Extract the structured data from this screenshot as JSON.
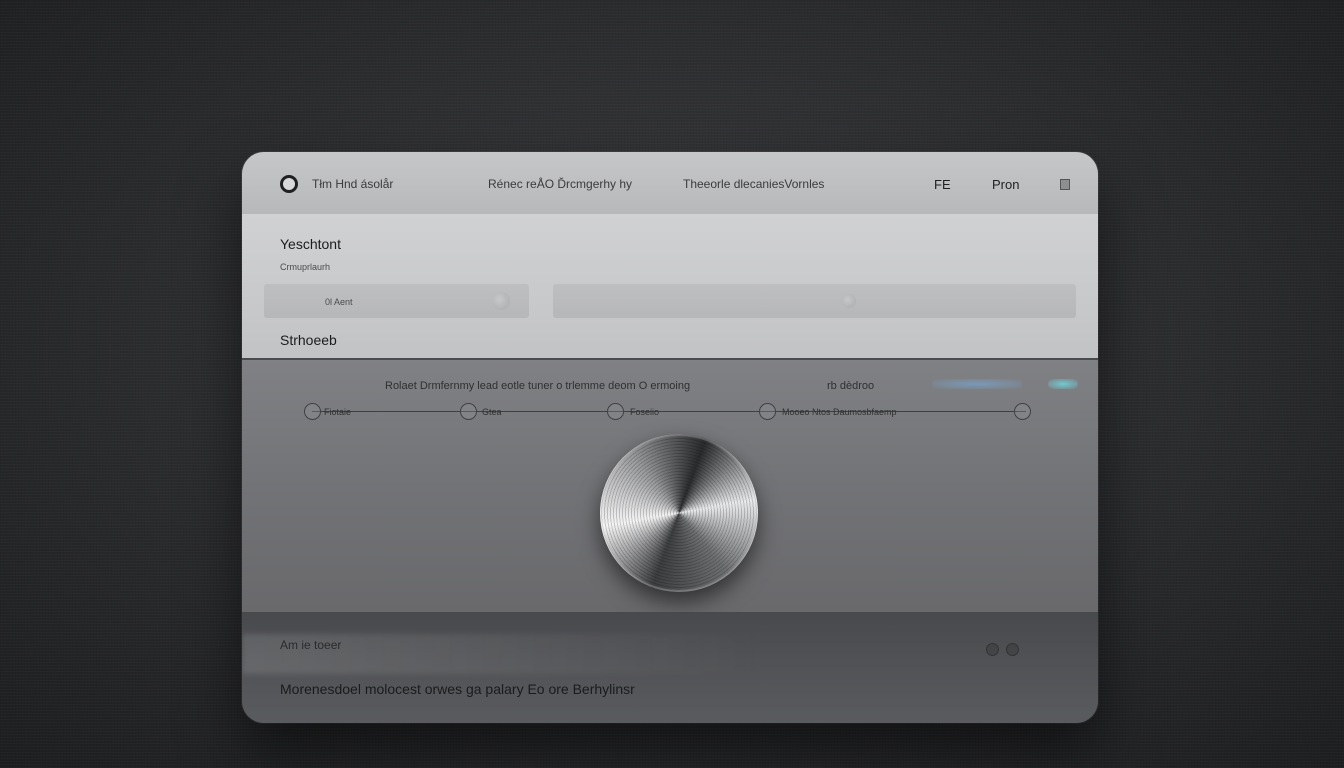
{
  "topbar": {
    "app_title": "Tłm Hnd ásolår",
    "nav_center": "Rénec reÅO Ďrcmgerhy hy",
    "nav_right": "Theeorle dlecaniesVornles",
    "btn_fe": "FE",
    "btn_pron": "Pron"
  },
  "panel": {
    "heading": "Yeschtont",
    "subheading": "Crmuprlaurh",
    "field_1_text": "0l Aent",
    "section_title": "Strhoeeb"
  },
  "stage": {
    "info_line": "Rolaet Drmfernmy lead eotle tuner o trlemme deom O ermoing",
    "info_tail": "rb dèdroo",
    "steps": [
      {
        "label": "Fiotaie"
      },
      {
        "label": "Gtea"
      },
      {
        "label": "Foseiio"
      },
      {
        "label": "Mooeo Ntos  Daumosbfaemp"
      },
      {
        "label": ""
      }
    ]
  },
  "bottom": {
    "blur_label": "Am ie toeer",
    "status_text": "Morenesdoel molocest orwes ga palary Eo ore Berhylinsr"
  },
  "colors": {
    "background": "#2b2c2e",
    "topbar": "#c0c1c3",
    "panel": "#cbcccd",
    "stage": "#767779",
    "accent_glow": "#78aadc"
  }
}
